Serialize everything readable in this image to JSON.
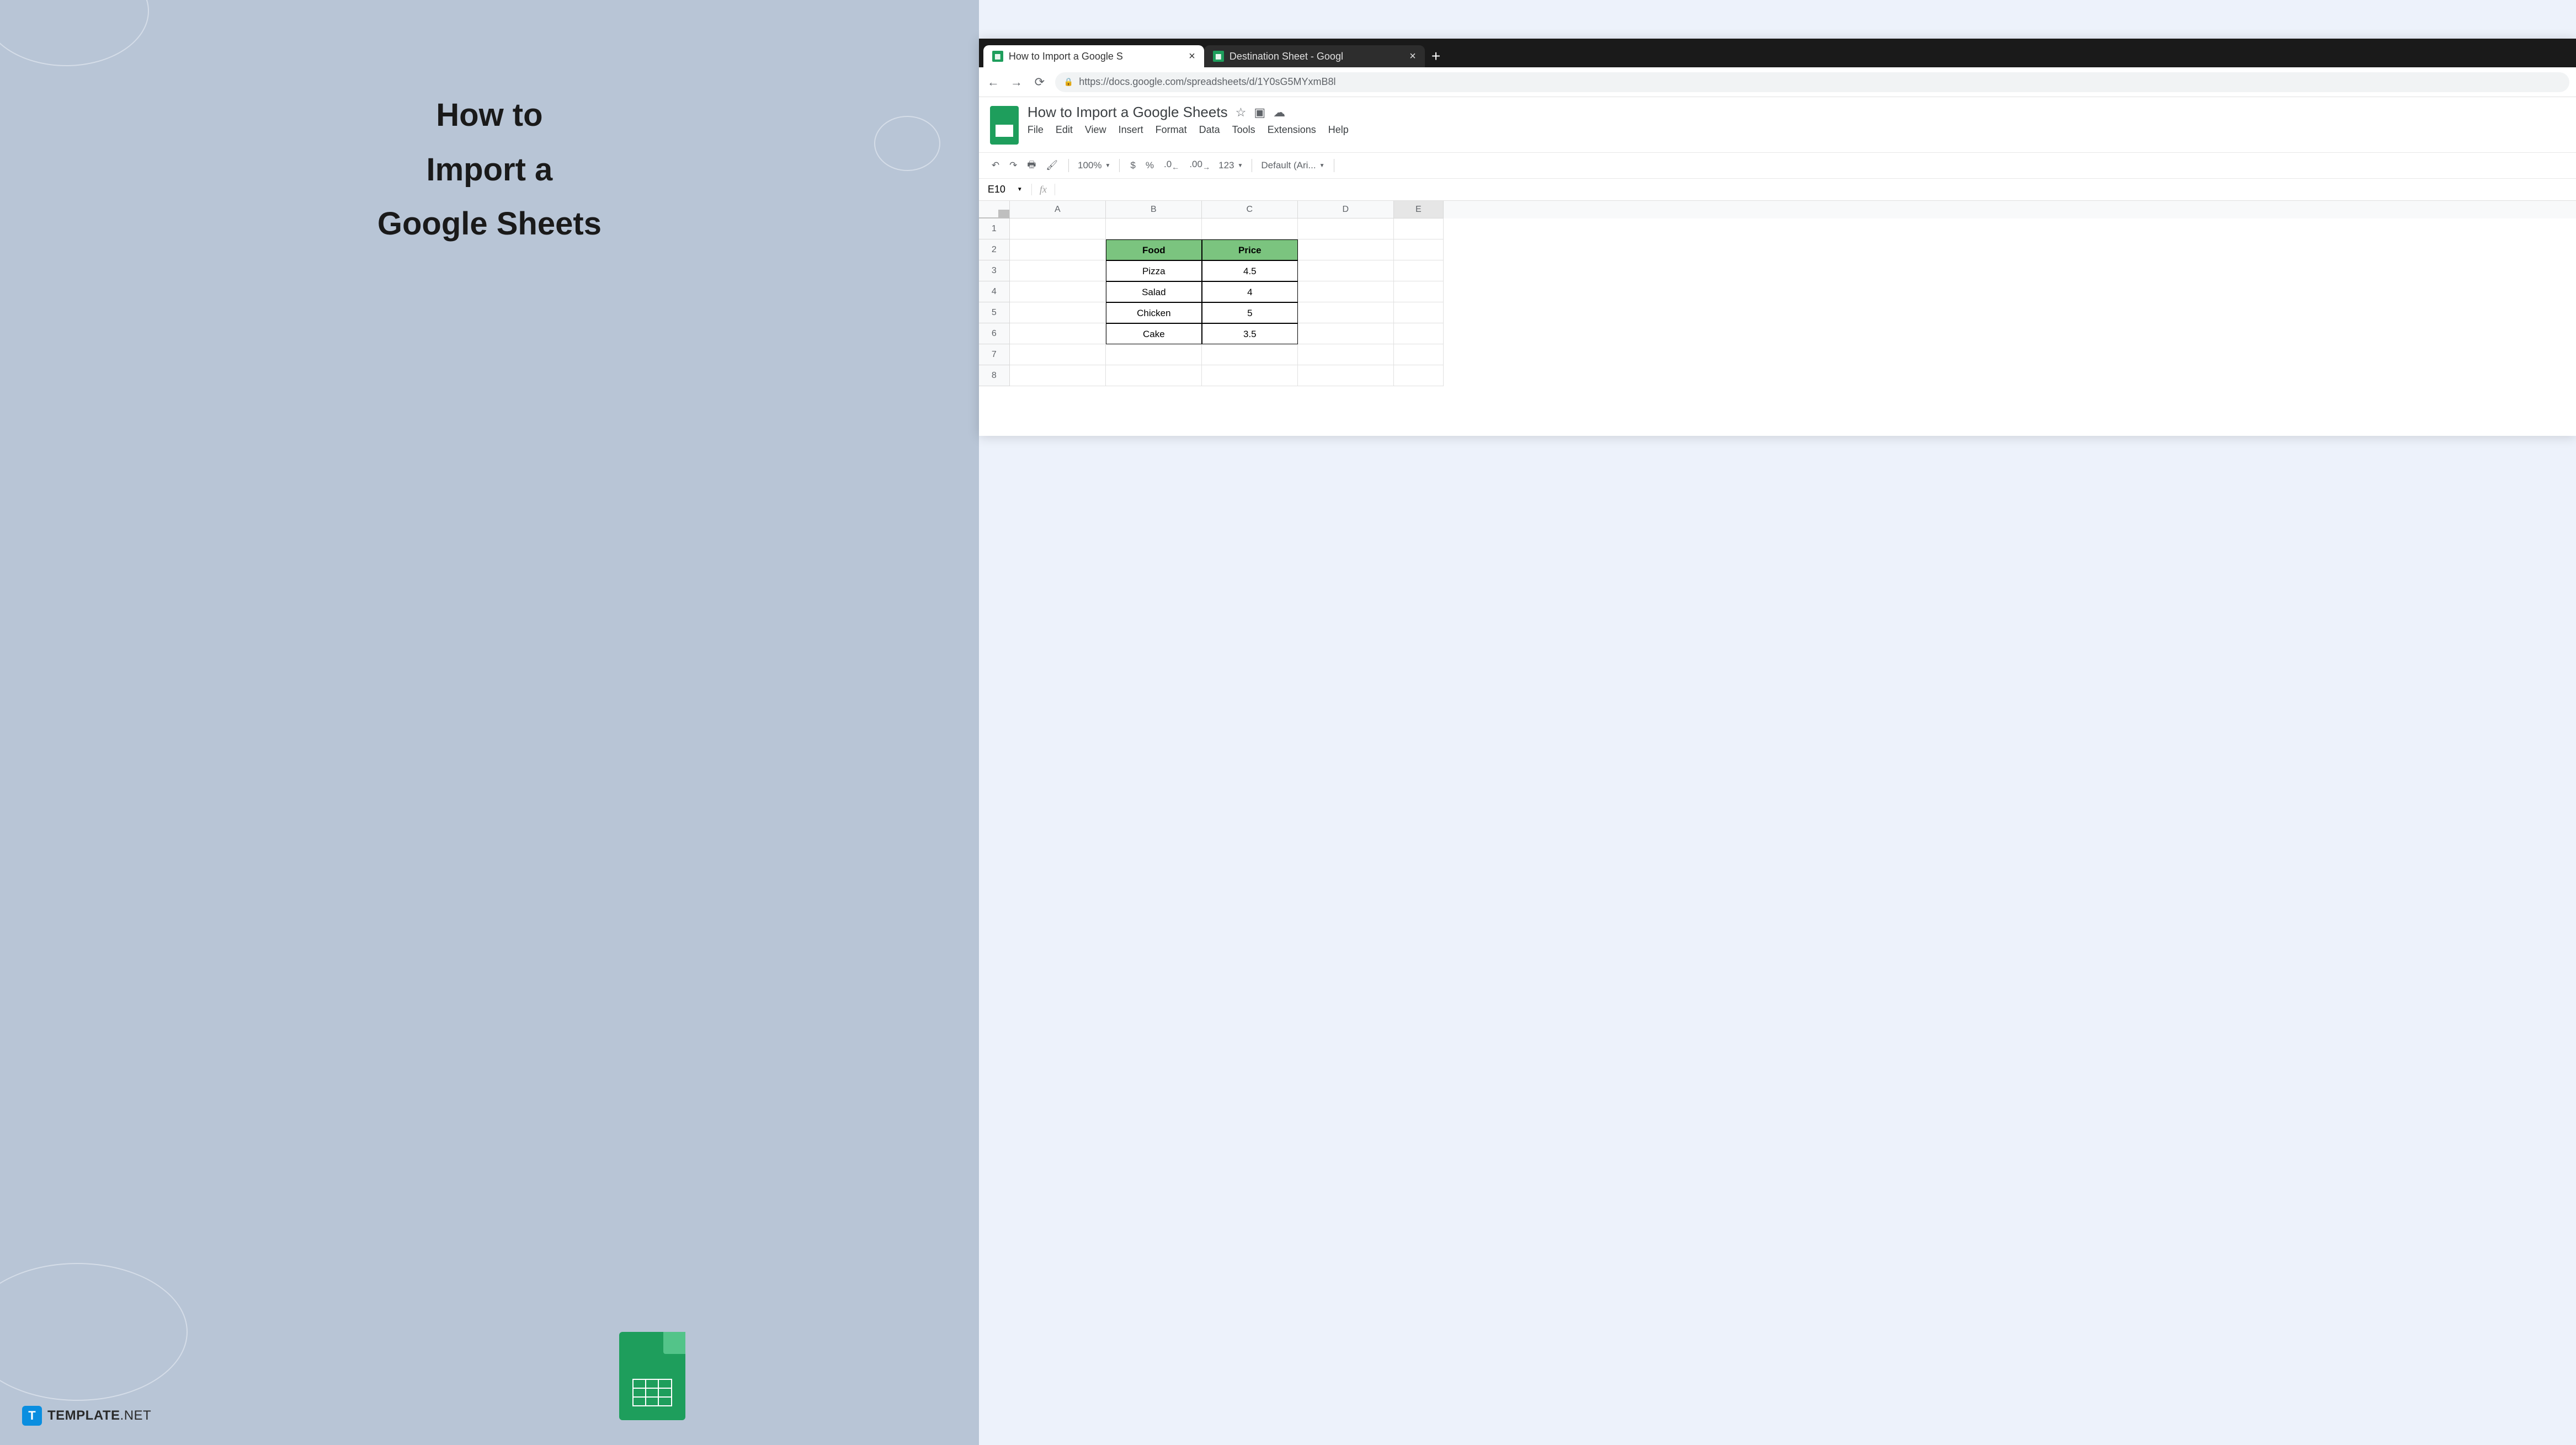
{
  "left": {
    "title_l1": "How to",
    "title_l2": "Import a",
    "title_l3": "Google Sheets"
  },
  "brand": {
    "icon_letter": "T",
    "name": "TEMPLATE",
    "suffix": ".NET"
  },
  "browser": {
    "tab1": "How to Import a Google S",
    "tab2": "Destination Sheet - Googl",
    "url": "https://docs.google.com/spreadsheets/d/1Y0sG5MYxmB8l"
  },
  "doc": {
    "title": "How to Import a Google Sheets"
  },
  "menu": [
    "File",
    "Edit",
    "View",
    "Insert",
    "Format",
    "Data",
    "Tools",
    "Extensions",
    "Help"
  ],
  "toolbar": {
    "zoom": "100%",
    "currency": "$",
    "percent": "%",
    "dec_dec": ".0",
    "inc_dec": ".00",
    "num_fmt": "123",
    "font": "Default (Ari..."
  },
  "formula": {
    "cell": "E10",
    "fx": "fx"
  },
  "columns": [
    "A",
    "B",
    "C",
    "D",
    "E"
  ],
  "row_nums": [
    "1",
    "2",
    "3",
    "4",
    "5",
    "6",
    "7",
    "8"
  ],
  "table": {
    "header": [
      "Food",
      "Price"
    ],
    "rows": [
      [
        "Pizza",
        "4.5"
      ],
      [
        "Salad",
        "4"
      ],
      [
        "Chicken",
        "5"
      ],
      [
        "Cake",
        "3.5"
      ]
    ]
  }
}
